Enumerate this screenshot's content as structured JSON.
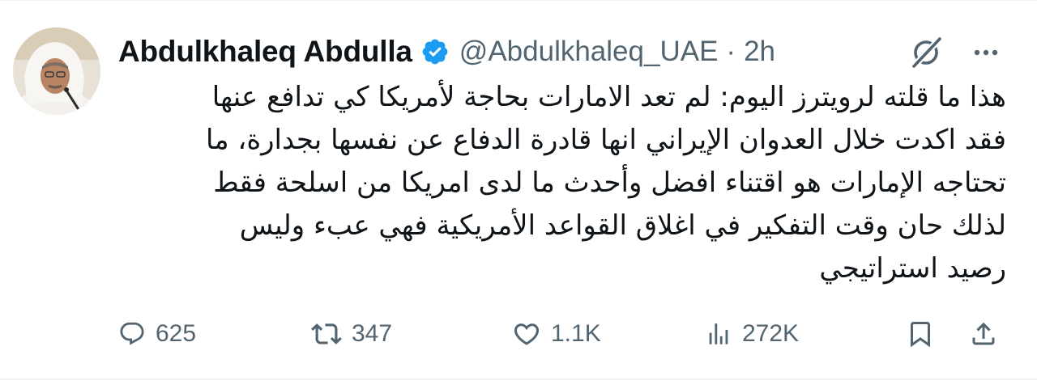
{
  "tweet": {
    "author_name": "Abdulkhaleq Abdulla",
    "handle": "@Abdulkhaleq_UAE",
    "separator": "·",
    "time": "2h",
    "text": "هذا ما قلته لرويترز اليوم: لم تعد الامارات بحاجة لأمريكا كي تدافع عنها\nفقد اكدت خلال العدوان الإيراني انها قادرة الدفاع عن نفسها بجدارة، ما\nتحتاجه الإمارات هو اقتناء افضل وأحدث ما لدى امريكا من اسلحة فقط\nلذلك حان وقت التفكير في اغلاق القواعد الأمريكية فهي عبء وليس\nرصيد استراتيجي"
  },
  "metrics": {
    "replies": "625",
    "reposts": "347",
    "likes": "1.1K",
    "views": "272K"
  },
  "icons": {
    "verified": "verified-badge-icon",
    "grok": "grok-icon",
    "more": "more-icon",
    "reply": "reply-icon",
    "repost": "repost-icon",
    "like": "like-icon",
    "views": "views-icon",
    "bookmark": "bookmark-icon",
    "share": "share-icon"
  },
  "colors": {
    "verified": "#1d9bf0",
    "secondary_text": "#536471",
    "primary_text": "#0f1419"
  }
}
